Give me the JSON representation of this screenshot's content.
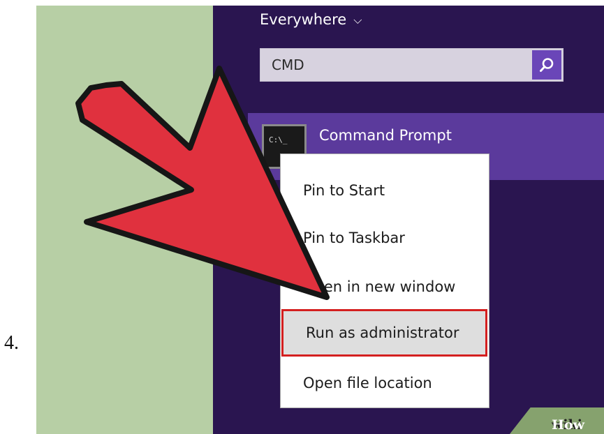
{
  "step": {
    "number": "4."
  },
  "search": {
    "scope_label": "Everywhere",
    "scope_chevron": "⌵",
    "query": "CMD",
    "button_icon": "search-icon"
  },
  "result": {
    "label": "Command Prompt",
    "icon_text": "C:\\_",
    "icon": "cmd-icon"
  },
  "context_menu": {
    "items": [
      {
        "label": "Pin to Start"
      },
      {
        "label": "Pin to Taskbar"
      },
      {
        "label": "Open in new window"
      },
      {
        "label": "Run as administrator",
        "highlighted": true
      },
      {
        "label": "Open file location"
      }
    ]
  },
  "watermark": {
    "wiki": "wiki",
    "how": "How"
  },
  "colors": {
    "panel_green": "#b7cfa5",
    "background_purple": "#2a1550",
    "selected_row": "#5b3a9c",
    "accent": "#6a46b8",
    "highlight_border": "#d41f1f",
    "arrow_fill": "#e0313e"
  }
}
